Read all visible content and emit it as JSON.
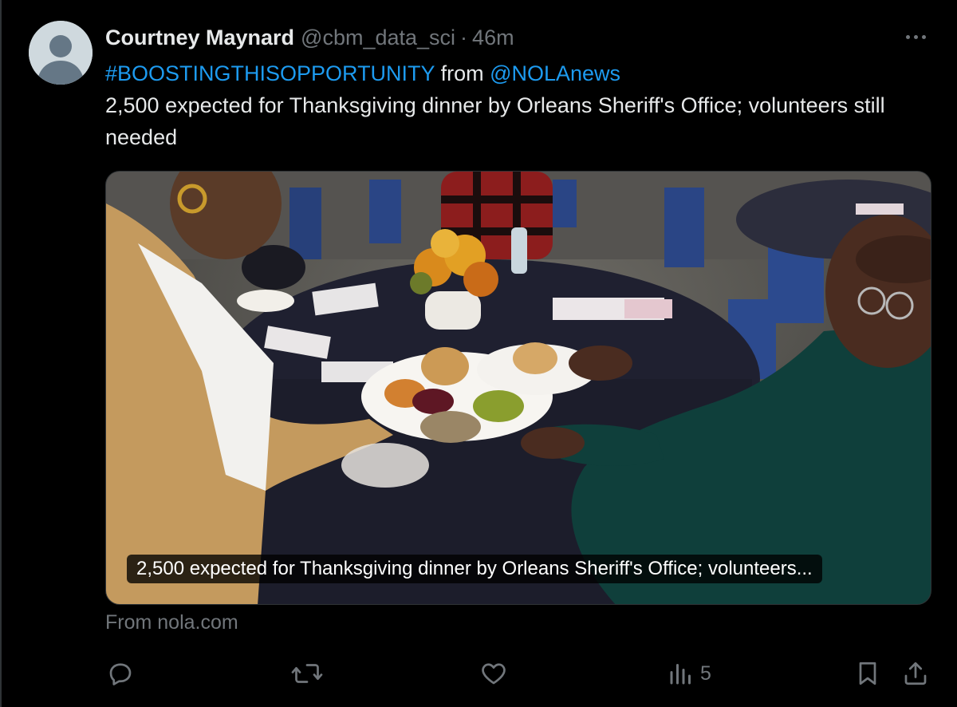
{
  "tweet": {
    "author_name": "Courtney Maynard",
    "handle": "@cbm_data_sci",
    "separator": "·",
    "time": "46m",
    "hashtag": "#BOOSTINGTHISOPPORTUNITY",
    "from_word": " from ",
    "mention": "@NOLAnews",
    "body_line": "2,500 expected for Thanksgiving dinner by Orleans Sheriff's Office; volunteers still needed"
  },
  "card": {
    "caption": "2,500 expected for Thanksgiving dinner by Orleans Sheriff's Office; volunteers...",
    "source": "From nola.com"
  },
  "actions": {
    "reply_icon": "reply-icon",
    "retweet_icon": "retweet-icon",
    "like_icon": "like-icon",
    "views_icon": "views-icon",
    "views_count": "5",
    "bookmark_icon": "bookmark-icon",
    "share_icon": "share-icon"
  },
  "colors": {
    "background": "#000000",
    "link": "#1d9bf0",
    "secondary_text": "#71767b",
    "primary_text": "#e7e9ea"
  }
}
